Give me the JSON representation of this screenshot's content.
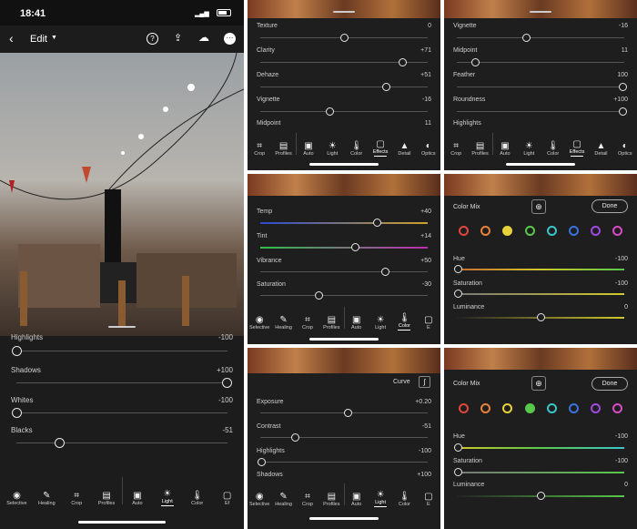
{
  "phone": {
    "time": "18:41",
    "edit_label": "Edit",
    "light_rows": [
      {
        "label": "Highlights",
        "value": "-100",
        "pos": 0.0
      },
      {
        "label": "Shadows",
        "value": "+100",
        "pos": 1.0
      },
      {
        "label": "Whites",
        "value": "-100",
        "pos": 0.0
      },
      {
        "label": "Blacks",
        "value": "-51",
        "pos": 0.24
      }
    ],
    "tools": [
      {
        "label": "Selective",
        "icon": "◉"
      },
      {
        "label": "Healing",
        "icon": "✎"
      },
      {
        "label": "Crop",
        "icon": "⌗"
      },
      {
        "label": "Profiles",
        "icon": "▤"
      },
      {
        "label": "Auto",
        "icon": "▣"
      },
      {
        "label": "Light",
        "icon": "☀"
      },
      {
        "label": "Color",
        "icon": "🌡"
      },
      {
        "label": "Ef",
        "icon": "▢"
      }
    ]
  },
  "effects_a": {
    "rows": [
      {
        "label": "Texture",
        "value": "0",
        "pos": 0.5
      },
      {
        "label": "Clarity",
        "value": "+71",
        "pos": 0.86
      },
      {
        "label": "Dehaze",
        "value": "+51",
        "pos": 0.76
      },
      {
        "label": "Vignette",
        "value": "-16",
        "pos": 0.42
      },
      {
        "label": "Midpoint",
        "value": "11",
        "pos": null
      }
    ],
    "tools": [
      {
        "label": "Crop",
        "icon": "⌗"
      },
      {
        "label": "Profiles",
        "icon": "▤"
      },
      {
        "label": "Auto",
        "icon": "▣"
      },
      {
        "label": "Light",
        "icon": "☀"
      },
      {
        "label": "Color",
        "icon": "🌡"
      },
      {
        "label": "Effects",
        "icon": "▢"
      },
      {
        "label": "Detail",
        "icon": "▲"
      },
      {
        "label": "Optics",
        "icon": "◐"
      }
    ]
  },
  "effects_b": {
    "rows": [
      {
        "label": "Vignette",
        "value": "-16",
        "pos": 0.42
      },
      {
        "label": "Midpoint",
        "value": "11",
        "pos": 0.0
      },
      {
        "label": "Feather",
        "value": "100",
        "pos": 1.0
      },
      {
        "label": "Roundness",
        "value": "+100",
        "pos": 1.0
      },
      {
        "label": "Highlights",
        "value": "",
        "pos": null
      }
    ],
    "tools": [
      {
        "label": "Crop",
        "icon": "⌗"
      },
      {
        "label": "Profiles",
        "icon": "▤"
      },
      {
        "label": "Auto",
        "icon": "▣"
      },
      {
        "label": "Light",
        "icon": "☀"
      },
      {
        "label": "Color",
        "icon": "🌡"
      },
      {
        "label": "Effects",
        "icon": "▢"
      },
      {
        "label": "Detail",
        "icon": "▲"
      },
      {
        "label": "Optics",
        "icon": "◐"
      }
    ]
  },
  "color_panel": {
    "rows": [
      {
        "label": "Temp",
        "value": "+40",
        "pos": 0.7
      },
      {
        "label": "Tint",
        "value": "+14",
        "pos": 0.57
      },
      {
        "label": "Vibrance",
        "value": "+50",
        "pos": 0.75
      },
      {
        "label": "Saturation",
        "value": "-30",
        "pos": 0.35
      }
    ],
    "tools": [
      {
        "label": "Selective",
        "icon": "◉"
      },
      {
        "label": "Healing",
        "icon": "✎"
      },
      {
        "label": "Crop",
        "icon": "⌗"
      },
      {
        "label": "Profiles",
        "icon": "▤"
      },
      {
        "label": "Auto",
        "icon": "▣"
      },
      {
        "label": "Light",
        "icon": "☀"
      },
      {
        "label": "Color",
        "icon": "🌡"
      },
      {
        "label": "E",
        "icon": "▢"
      }
    ]
  },
  "colormix_a": {
    "title": "Color Mix",
    "done": "Done",
    "swatches": [
      "#e0483e",
      "#e8823a",
      "#e8d23a",
      "#58c84a",
      "#3ac6c8",
      "#3a72e0",
      "#a04ae0",
      "#d84ac8"
    ],
    "rows": [
      {
        "label": "Hue",
        "value": "-100",
        "pos": 0.0
      },
      {
        "label": "Saturation",
        "value": "-100",
        "pos": 0.0
      },
      {
        "label": "Luminance",
        "value": "0",
        "pos": 0.5
      }
    ]
  },
  "light_panel": {
    "curve": "Curve",
    "rows": [
      {
        "label": "Exposure",
        "value": "+0.20",
        "pos": 0.51
      },
      {
        "label": "Contrast",
        "value": "-51",
        "pos": 0.24
      },
      {
        "label": "Highlights",
        "value": "-100",
        "pos": 0.0
      },
      {
        "label": "Shadows",
        "value": "+100",
        "pos": null
      }
    ],
    "tools": [
      {
        "label": "Selective",
        "icon": "◉"
      },
      {
        "label": "Healing",
        "icon": "✎"
      },
      {
        "label": "Crop",
        "icon": "⌗"
      },
      {
        "label": "Profiles",
        "icon": "▤"
      },
      {
        "label": "Auto",
        "icon": "▣"
      },
      {
        "label": "Light",
        "icon": "☀"
      },
      {
        "label": "Color",
        "icon": "🌡"
      },
      {
        "label": "E",
        "icon": "▢"
      }
    ]
  },
  "colormix_b": {
    "title": "Color Mix",
    "done": "Done",
    "swatches": [
      "#e0483e",
      "#e8823a",
      "#e8d23a",
      "#58c84a",
      "#3ac6c8",
      "#3a72e0",
      "#a04ae0",
      "#d84ac8"
    ],
    "rows": [
      {
        "label": "Hue",
        "value": "-100",
        "pos": 0.0
      },
      {
        "label": "Saturation",
        "value": "-100",
        "pos": 0.0
      },
      {
        "label": "Luminance",
        "value": "0",
        "pos": 0.5
      }
    ]
  }
}
